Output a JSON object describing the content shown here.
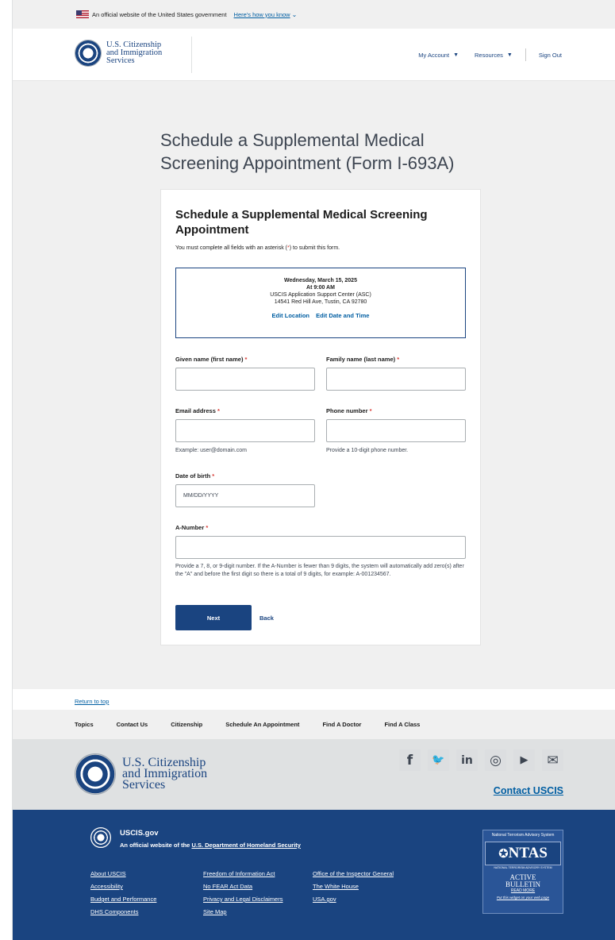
{
  "banner": {
    "official_text": "An official website of the United States government",
    "how_link": "Here's how you know",
    "how_chevron": "⌄"
  },
  "header": {
    "logo_line1": "U.S. Citizenship",
    "logo_line2": "and Immigration",
    "logo_line3": "Services",
    "nav": {
      "my_account": "My Account",
      "resources": "Resources",
      "sign_out": "Sign Out",
      "caret": "▼"
    }
  },
  "page": {
    "title": "Schedule a Supplemental Medical Screening Appointment (Form I-693A)"
  },
  "form": {
    "title": "Schedule a Supplemental Medical Screening Appointment",
    "intro_prefix": "You must complete all fields with an asterisk (",
    "intro_asterisk": "*",
    "intro_suffix": ") to submit this form.",
    "appointment": {
      "date": "Wednesday, March 15, 2025",
      "time": "At 9:00 AM",
      "location_name": "USCIS Application Support Center (ASC)",
      "address": "14541 Red Hill Ave, Tustin, CA 92780",
      "edit_location": "Edit Location",
      "edit_date_time": "Edit Date and Time"
    },
    "required_marker": "*",
    "fields": {
      "given_name": {
        "label": "Given name (first name)",
        "value": ""
      },
      "family_name": {
        "label": "Family name (last name)",
        "value": ""
      },
      "email": {
        "label": "Email address",
        "value": "",
        "hint": "Example: user@domain.com"
      },
      "phone": {
        "label": "Phone number",
        "value": "",
        "hint": "Provide a 10-digit phone number."
      },
      "dob": {
        "label": "Date of birth",
        "placeholder": "MM/DD/YYYY",
        "value": ""
      },
      "a_number": {
        "label": "A-Number",
        "value": "",
        "hint": "Provide a 7, 8, or 9-digit number. If the A-Number is fewer than 9 digits, the system will automatically add zero(s) after the \"A\" and before the first digit so there is a total of 9 digits, for example: A-001234567."
      }
    },
    "next_label": "Next",
    "back_label": "Back"
  },
  "footer": {
    "return_to_top": "Return to top",
    "nav": [
      "Topics",
      "Contact Us",
      "Citizenship",
      "Schedule An Appointment",
      "Find A Doctor",
      "Find A Class"
    ],
    "logo_line1": "U.S. Citizenship",
    "logo_line2": "and Immigration",
    "logo_line3": "Services",
    "social": [
      "facebook-icon",
      "twitter-icon",
      "linkedin-icon",
      "instagram-icon",
      "youtube-icon",
      "email-icon"
    ],
    "social_glyphs": [
      "f",
      "🐦",
      "in",
      "◎",
      "▶",
      "✉"
    ],
    "contact_link": "Contact USCIS",
    "brand": "USCIS.gov",
    "official_prefix": "An official website of the ",
    "official_dhs": "U.S. Department of Homeland Security",
    "links": [
      "About USCIS",
      "Freedom of Information Act",
      "Office of the Inspector General",
      "Accessibility",
      "No FEAR Act Data",
      "The White House",
      "Budget and Performance",
      "Privacy and Legal Disclaimers",
      "USA.gov",
      "DHS Components",
      "Site Map"
    ],
    "ntas": {
      "top": "National Terrorism Advisory System",
      "logo": "NTAS",
      "sub": "NATIONAL TERRORISM ADVISORY SYSTEM",
      "active": "ACTIVE",
      "bulletin": "BULLETIN",
      "read_more": "READ MORE",
      "widget": "Put this widget on your web page"
    }
  }
}
